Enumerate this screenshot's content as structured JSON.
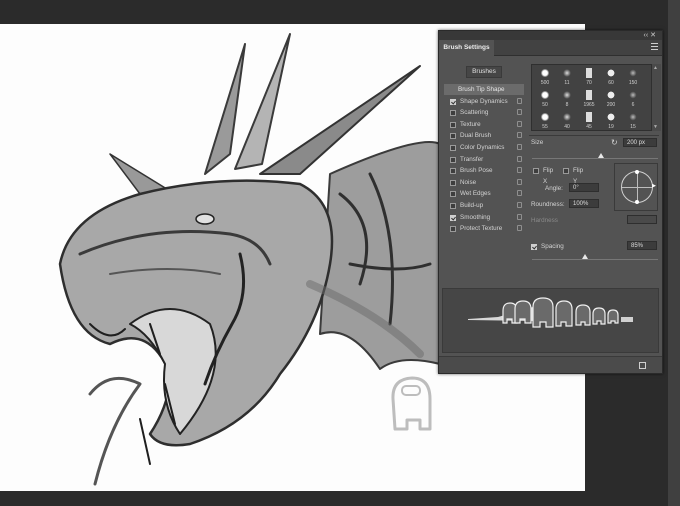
{
  "panel": {
    "tab": "Brush Settings",
    "collapse_glyph": "‹‹ ✕",
    "brushes_button": "Brushes",
    "options": [
      {
        "label": "Brush Tip Shape",
        "checked": null,
        "active": true
      },
      {
        "label": "Shape Dynamics",
        "checked": true
      },
      {
        "label": "Scattering",
        "checked": false
      },
      {
        "label": "Texture",
        "checked": false
      },
      {
        "label": "Dual Brush",
        "checked": false
      },
      {
        "label": "Color Dynamics",
        "checked": false
      },
      {
        "label": "Transfer",
        "checked": false
      },
      {
        "label": "Brush Pose",
        "checked": false
      },
      {
        "label": "Noise",
        "checked": false
      },
      {
        "label": "Wet Edges",
        "checked": false
      },
      {
        "label": "Build-up",
        "checked": false
      },
      {
        "label": "Smoothing",
        "checked": true
      },
      {
        "label": "Protect Texture",
        "checked": false
      }
    ],
    "brush_sizes_row1": [
      "500",
      "11",
      "70",
      "60",
      "150"
    ],
    "brush_sizes_row2": [
      "50",
      "8",
      "1965",
      "200",
      "6"
    ],
    "brush_sizes_row3": [
      "55",
      "40",
      "45",
      "19",
      "15"
    ],
    "size_label": "Size",
    "size_value": "200 px",
    "flip_x": "Flip X",
    "flip_y": "Flip Y",
    "angle_label": "Angle:",
    "angle_value": "0°",
    "roundness_label": "Roundness:",
    "roundness_value": "100%",
    "hardness_label": "Hardness",
    "spacing_label": "Spacing",
    "spacing_value": "85%",
    "size_slider_level": 0.55,
    "spacing_slider_level": 0.42
  },
  "colors": {
    "panel_bg": "#535353",
    "canvas": "#fdfdfd",
    "workspace": "#2b2b2b"
  }
}
